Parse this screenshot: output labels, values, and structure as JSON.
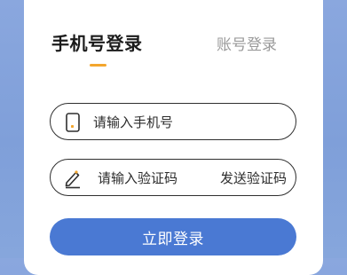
{
  "tabs": {
    "phone_login": "手机号登录",
    "account_login": "账号登录"
  },
  "phone_field": {
    "placeholder": "请输入手机号"
  },
  "code_field": {
    "placeholder": "请输入验证码",
    "send_code_label": "发送验证码"
  },
  "login_button": {
    "label": "立即登录"
  },
  "colors": {
    "background": "#86a6dc",
    "accent_underline": "#f3a62d",
    "button": "#4a79d3"
  },
  "icons": [
    "phone-icon",
    "pencil-icon"
  ]
}
